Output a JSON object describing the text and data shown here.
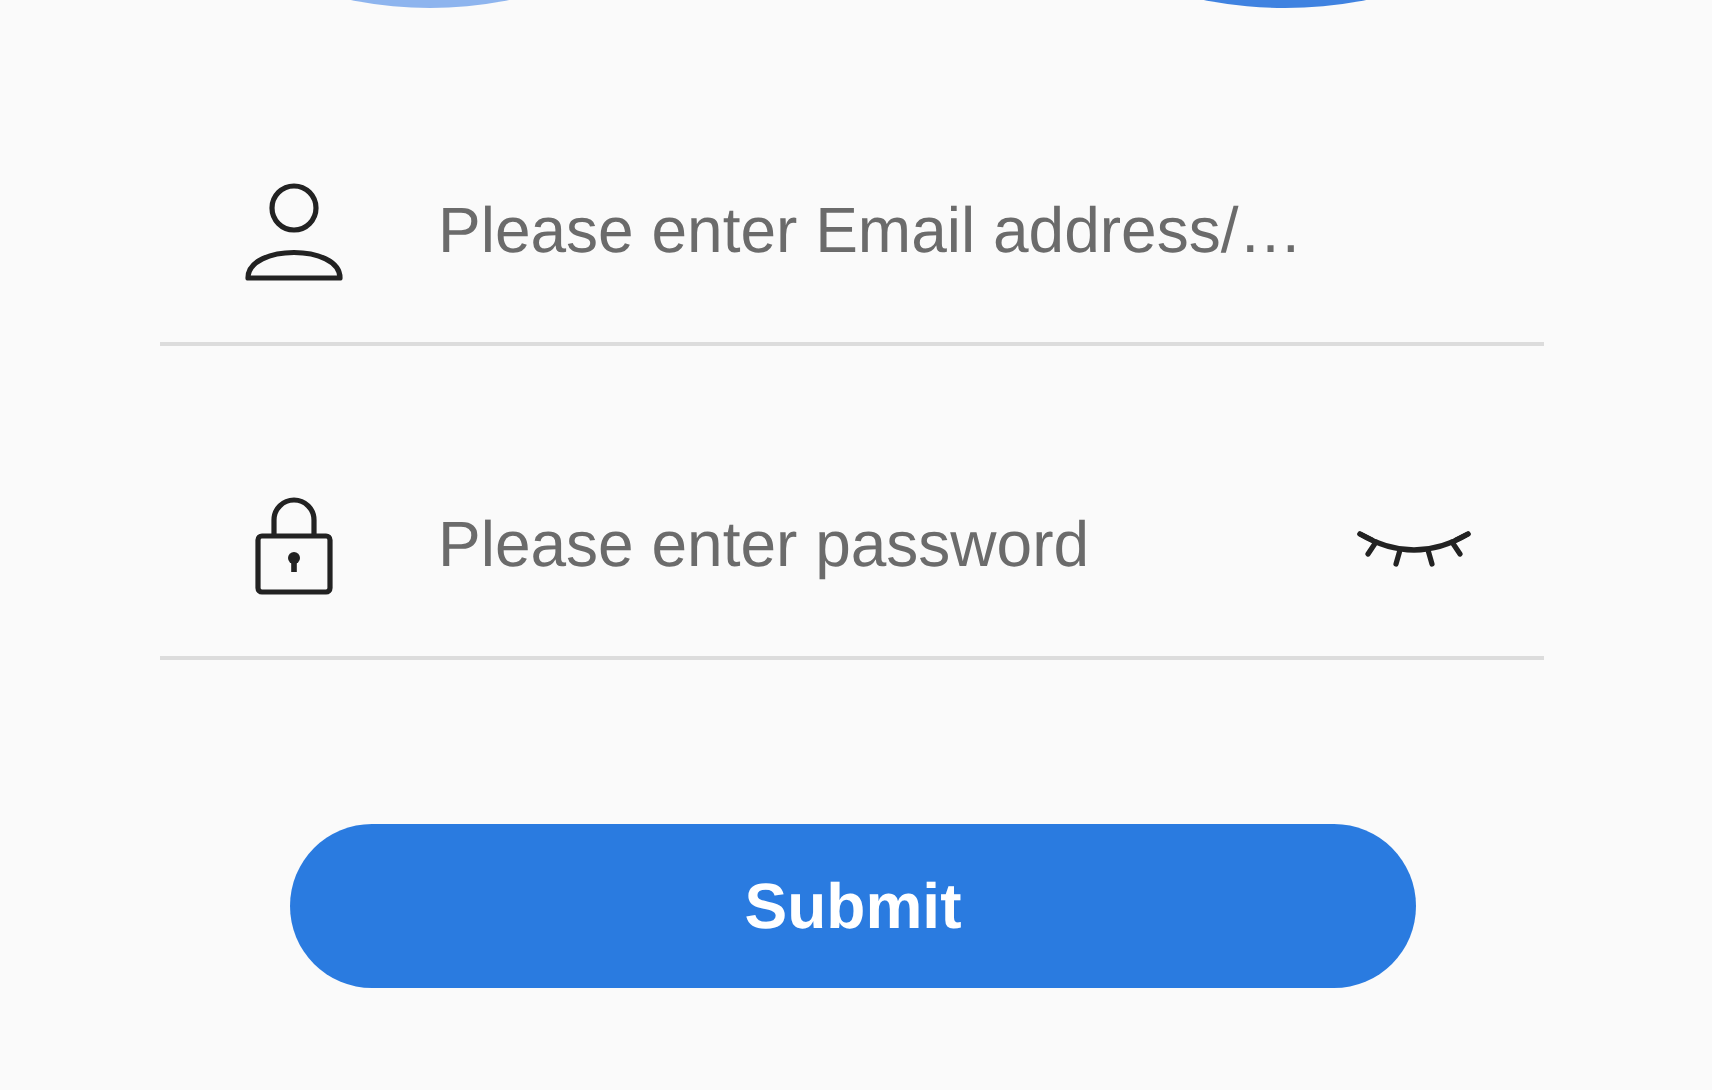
{
  "email_field": {
    "placeholder": "Please enter Email address/…"
  },
  "password_field": {
    "placeholder": "Please enter password",
    "password_visible": false
  },
  "submit_button": {
    "label": "Submit"
  }
}
